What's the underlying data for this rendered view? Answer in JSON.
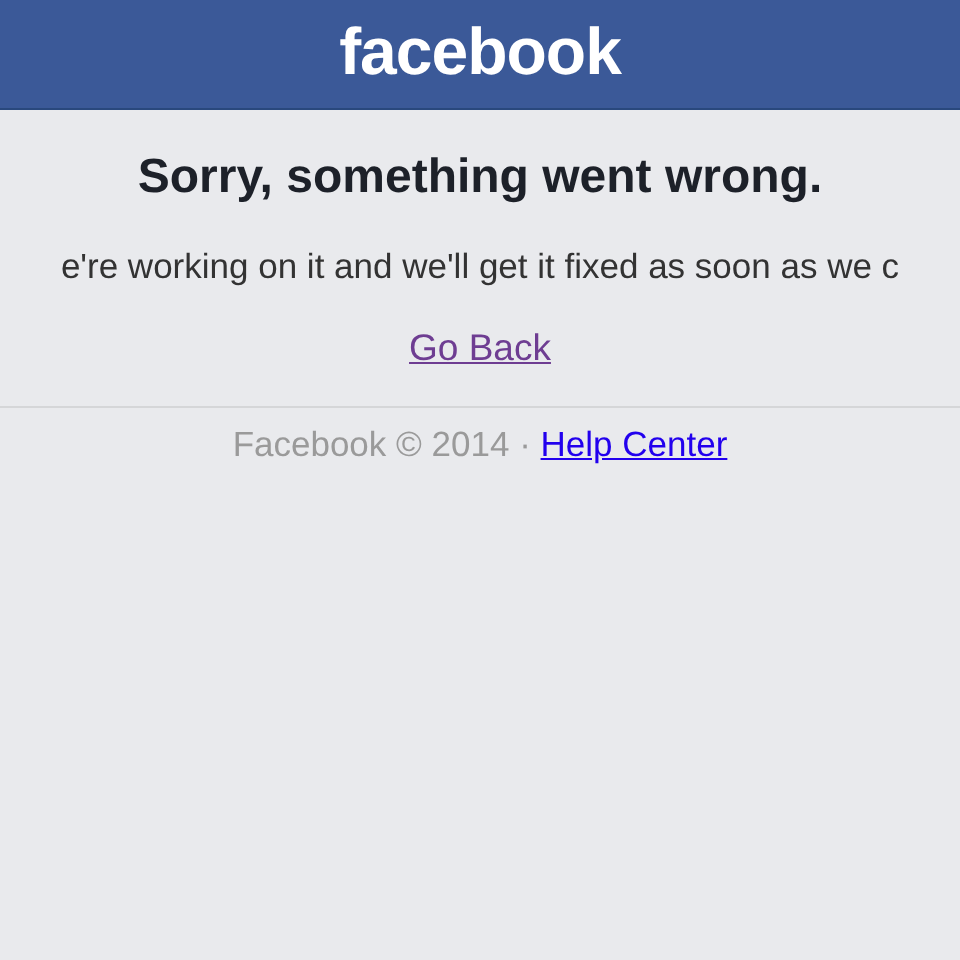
{
  "header": {
    "logo": "facebook"
  },
  "error": {
    "title": "Sorry, something went wrong.",
    "message": "e're working on it and we'll get it fixed as soon as we c",
    "link": "Go Back"
  },
  "footer": {
    "copyright": "Facebook © 2014 · ",
    "link": "Help Center"
  }
}
